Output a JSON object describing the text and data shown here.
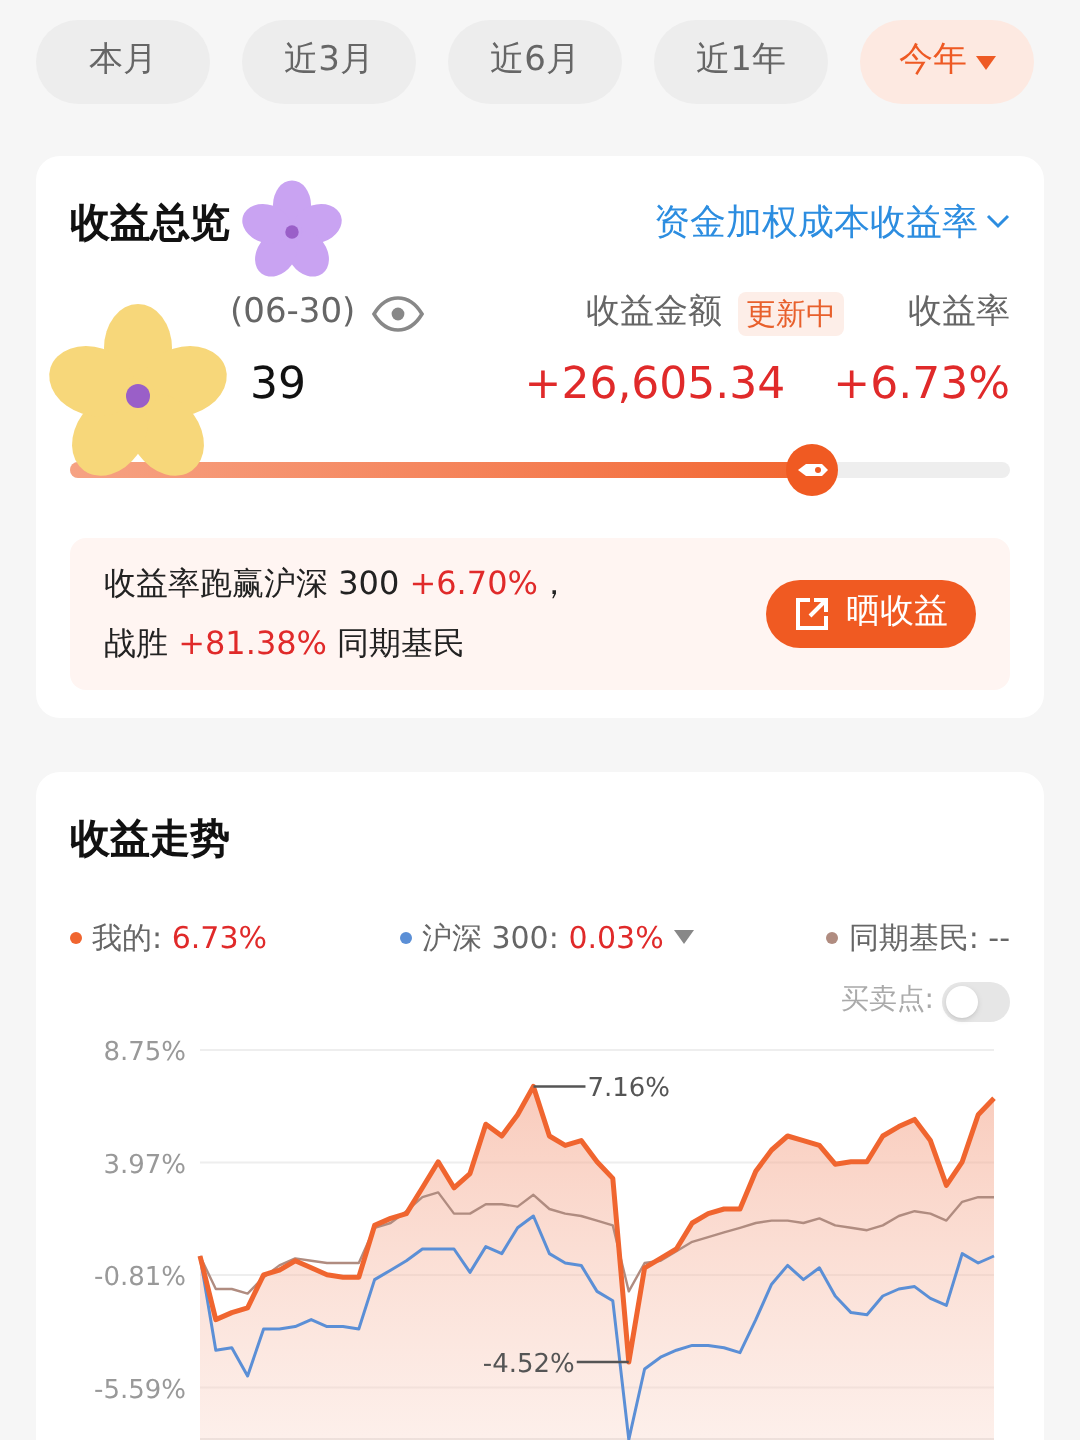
{
  "period_tabs": [
    {
      "label": "本月",
      "selected": false,
      "dropdown": false
    },
    {
      "label": "近3月",
      "selected": false,
      "dropdown": false
    },
    {
      "label": "近6月",
      "selected": false,
      "dropdown": false
    },
    {
      "label": "近1年",
      "selected": false,
      "dropdown": false
    },
    {
      "label": "今年",
      "selected": true,
      "dropdown": true
    }
  ],
  "overview": {
    "title": "收益总览",
    "metric_selector": "资金加权成本收益率",
    "asset_label": "(06-30)",
    "asset_value": "39",
    "profit_label": "收益金额",
    "profit_badge": "更新中",
    "rate_label": "收益率",
    "profit_value": "+26,605.34",
    "rate_value": "+6.73%",
    "progress": {
      "level": 0.79
    },
    "summary_lines": [
      [
        {
          "kind": "plain",
          "text": "收益率跑赢沪深 300 "
        },
        {
          "kind": "highlight",
          "text": "+6.70%"
        },
        {
          "kind": "plain",
          "text": "，"
        }
      ],
      [
        {
          "kind": "plain",
          "text": "战胜 "
        },
        {
          "kind": "highlight",
          "text": "+81.38%"
        },
        {
          "kind": "plain",
          "text": " 同期基民"
        }
      ]
    ],
    "share_button": "晒收益"
  },
  "stickers": [
    {
      "kind": "flower",
      "color": "#c9a3f2"
    },
    {
      "kind": "flower",
      "color": "#f7d77a"
    }
  ],
  "trend": {
    "title": "收益走势",
    "legend": [
      {
        "separator": ":",
        "value": "6.73%",
        "dropdown": false
      },
      {
        "separator": ":",
        "value": "0.03%",
        "dropdown": true
      },
      {
        "separator": ":",
        "value": "--",
        "dropdown": false
      }
    ],
    "trade_points": {
      "label": "买卖点:",
      "on": false
    },
    "chart_data": {
      "type": "line",
      "series": [
        {
          "name": "我的",
          "color": "#f0652f",
          "type": "area",
          "values": [
            0.0,
            -2.7,
            -2.4,
            -2.2,
            -0.8,
            -0.6,
            -0.2,
            -0.5,
            -0.8,
            -0.9,
            -0.9,
            1.3,
            1.6,
            1.8,
            2.9,
            4.0,
            2.9,
            3.5,
            5.6,
            5.1,
            6.0,
            7.2,
            5.1,
            4.7,
            4.9,
            4.0,
            3.3,
            -4.5,
            -0.5,
            -0.1,
            0.3,
            1.4,
            1.8,
            2.0,
            2.0,
            3.6,
            4.5,
            5.1,
            4.9,
            4.7,
            3.9,
            4.0,
            4.0,
            5.1,
            5.5,
            5.8,
            4.9,
            3.0,
            4.0,
            6.0,
            6.7
          ]
        },
        {
          "name": "沪深 300",
          "color": "#5b8fd6",
          "type": "line",
          "values": [
            0.0,
            -4.0,
            -3.9,
            -5.1,
            -3.1,
            -3.1,
            -3.0,
            -2.7,
            -3.0,
            -3.0,
            -3.1,
            -1.0,
            -0.6,
            -0.2,
            0.3,
            0.3,
            0.3,
            -0.7,
            0.4,
            0.1,
            1.2,
            1.7,
            0.1,
            -0.3,
            -0.4,
            -1.5,
            -1.9,
            -7.8,
            -4.8,
            -4.3,
            -4.0,
            -3.8,
            -3.8,
            -3.9,
            -4.1,
            -2.7,
            -1.2,
            -0.4,
            -1.0,
            -0.5,
            -1.7,
            -2.4,
            -2.5,
            -1.7,
            -1.4,
            -1.3,
            -1.8,
            -2.1,
            0.1,
            -0.3,
            0.0
          ]
        },
        {
          "name": "同期基民",
          "color": "#b08c80",
          "type": "line",
          "values": [
            0.0,
            -1.4,
            -1.4,
            -1.6,
            -0.9,
            -0.4,
            -0.1,
            -0.2,
            -0.3,
            -0.3,
            -0.3,
            1.2,
            1.4,
            1.9,
            2.5,
            2.7,
            1.8,
            1.8,
            2.2,
            2.2,
            2.1,
            2.6,
            2.0,
            1.8,
            1.7,
            1.5,
            1.3,
            -1.5,
            -0.3,
            -0.2,
            0.2,
            0.6,
            0.8,
            1.0,
            1.2,
            1.4,
            1.5,
            1.5,
            1.4,
            1.6,
            1.3,
            1.2,
            1.1,
            1.3,
            1.7,
            1.9,
            1.8,
            1.5,
            2.3,
            2.5,
            2.5
          ]
        }
      ],
      "ylim": [
        -7.9,
        8.75
      ],
      "grid": true,
      "yticks": [
        {
          "value": 8.75,
          "label": "8.75%"
        },
        {
          "value": 3.97,
          "label": "3.97%"
        },
        {
          "value": -0.81,
          "label": "-0.81%"
        },
        {
          "value": -5.59,
          "label": "-5.59%"
        }
      ],
      "annotations": [
        "7.16%",
        "-4.52%"
      ]
    }
  }
}
